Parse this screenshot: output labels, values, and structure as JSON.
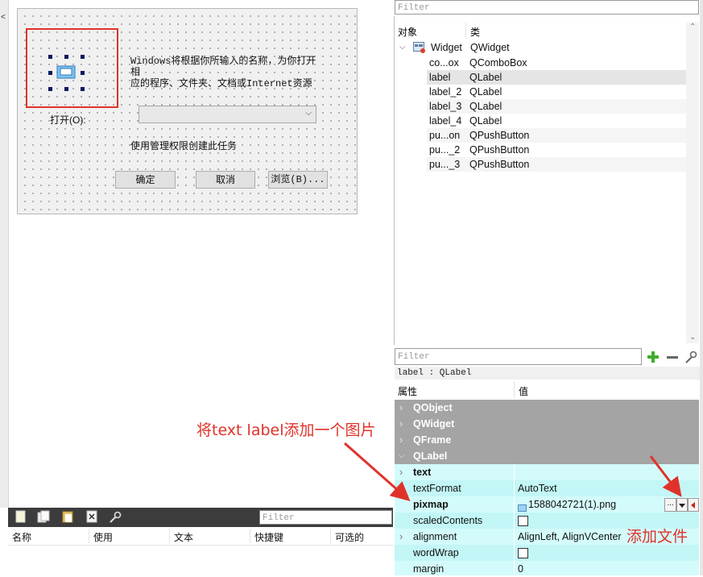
{
  "form": {
    "description_line1": "Windows将根据你所输入的名称，为你打开相",
    "description_line2": "应的程序、文件夹、文档或Internet资源",
    "open_label": "打开(O):",
    "combo_arrow": "⌵",
    "admin_text": "使用管理权限创建此任务",
    "ok_label": "确定",
    "cancel_label": "取消",
    "browse_label": "浏览(B)..."
  },
  "object_inspector": {
    "filter_placeholder": "Filter",
    "col_object": "对象",
    "col_class": "类",
    "root": {
      "name": "Widget",
      "class": "QWidget"
    },
    "children": [
      {
        "name": "co...ox",
        "class": "QComboBox"
      },
      {
        "name": "label",
        "class": "QLabel"
      },
      {
        "name": "label_2",
        "class": "QLabel"
      },
      {
        "name": "label_3",
        "class": "QLabel"
      },
      {
        "name": "label_4",
        "class": "QLabel"
      },
      {
        "name": "pu...on",
        "class": "QPushButton"
      },
      {
        "name": "pu..._2",
        "class": "QPushButton"
      },
      {
        "name": "pu..._3",
        "class": "QPushButton"
      }
    ],
    "selected_index": 1
  },
  "property_editor": {
    "filter_placeholder": "Filter",
    "title": "label : QLabel",
    "col_property": "属性",
    "col_value": "值",
    "groups": [
      "QObject",
      "QWidget",
      "QFrame",
      "QLabel"
    ],
    "properties": [
      {
        "name": "text",
        "value": "",
        "bold": true,
        "expandable": true
      },
      {
        "name": "textFormat",
        "value": "AutoText"
      },
      {
        "name": "pixmap",
        "value": "1588042721(1).png",
        "bold": true
      },
      {
        "name": "scaledContents",
        "value": "",
        "checkbox": true
      },
      {
        "name": "alignment",
        "value": "AlignLeft, AlignVCenter",
        "expandable": true
      },
      {
        "name": "wordWrap",
        "value": "",
        "checkbox": true
      },
      {
        "name": "margin",
        "value": "0"
      }
    ],
    "pixmap_browse_label": "..."
  },
  "action_editor": {
    "filter_placeholder": "Filter",
    "columns": [
      "名称",
      "使用",
      "文本",
      "快捷键",
      "可选的"
    ]
  },
  "annotations": {
    "add_image_note": "将text label添加一个图片",
    "add_file_note": "添加文件"
  },
  "colors": {
    "annotation": "#e0322a",
    "property_row": "#d4fbfb",
    "group_header": "#a4a4a4",
    "selection": "#e5e5e5"
  }
}
